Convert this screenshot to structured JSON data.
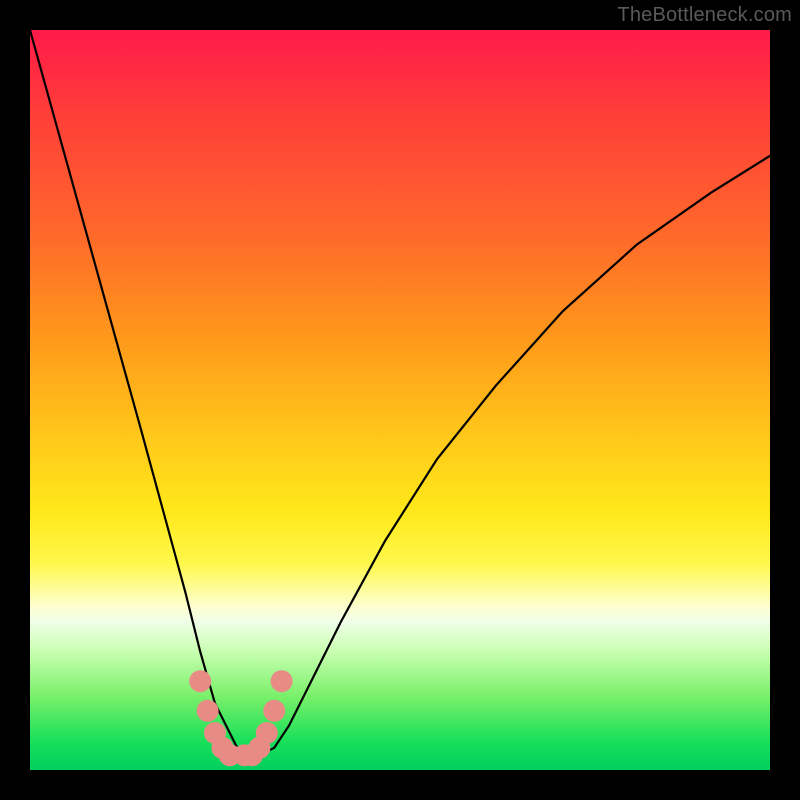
{
  "watermark": "TheBottleneck.com",
  "chart_data": {
    "type": "line",
    "title": "",
    "xlabel": "",
    "ylabel": "",
    "xlim": [
      0,
      100
    ],
    "ylim": [
      0,
      100
    ],
    "grid": false,
    "legend": false,
    "series": [
      {
        "name": "bottleneck-curve",
        "x": [
          0,
          5,
          10,
          15,
          18,
          21,
          23,
          25,
          27,
          28,
          29,
          30,
          31,
          33,
          35,
          38,
          42,
          48,
          55,
          63,
          72,
          82,
          92,
          100
        ],
        "y": [
          100,
          82,
          64,
          46,
          35,
          24,
          16,
          9,
          5,
          3,
          2,
          2,
          2,
          3,
          6,
          12,
          20,
          31,
          42,
          52,
          62,
          71,
          78,
          83
        ]
      }
    ],
    "annotations": [
      {
        "name": "marker-cluster",
        "shape": "rounded-blob",
        "color": "#e98b85",
        "approx_points_xy": [
          [
            23,
            12
          ],
          [
            24,
            8
          ],
          [
            25,
            5
          ],
          [
            26,
            3
          ],
          [
            27,
            2
          ],
          [
            29,
            2
          ],
          [
            30,
            2
          ],
          [
            31,
            3
          ],
          [
            32,
            5
          ],
          [
            33,
            8
          ],
          [
            34,
            12
          ]
        ]
      }
    ]
  }
}
